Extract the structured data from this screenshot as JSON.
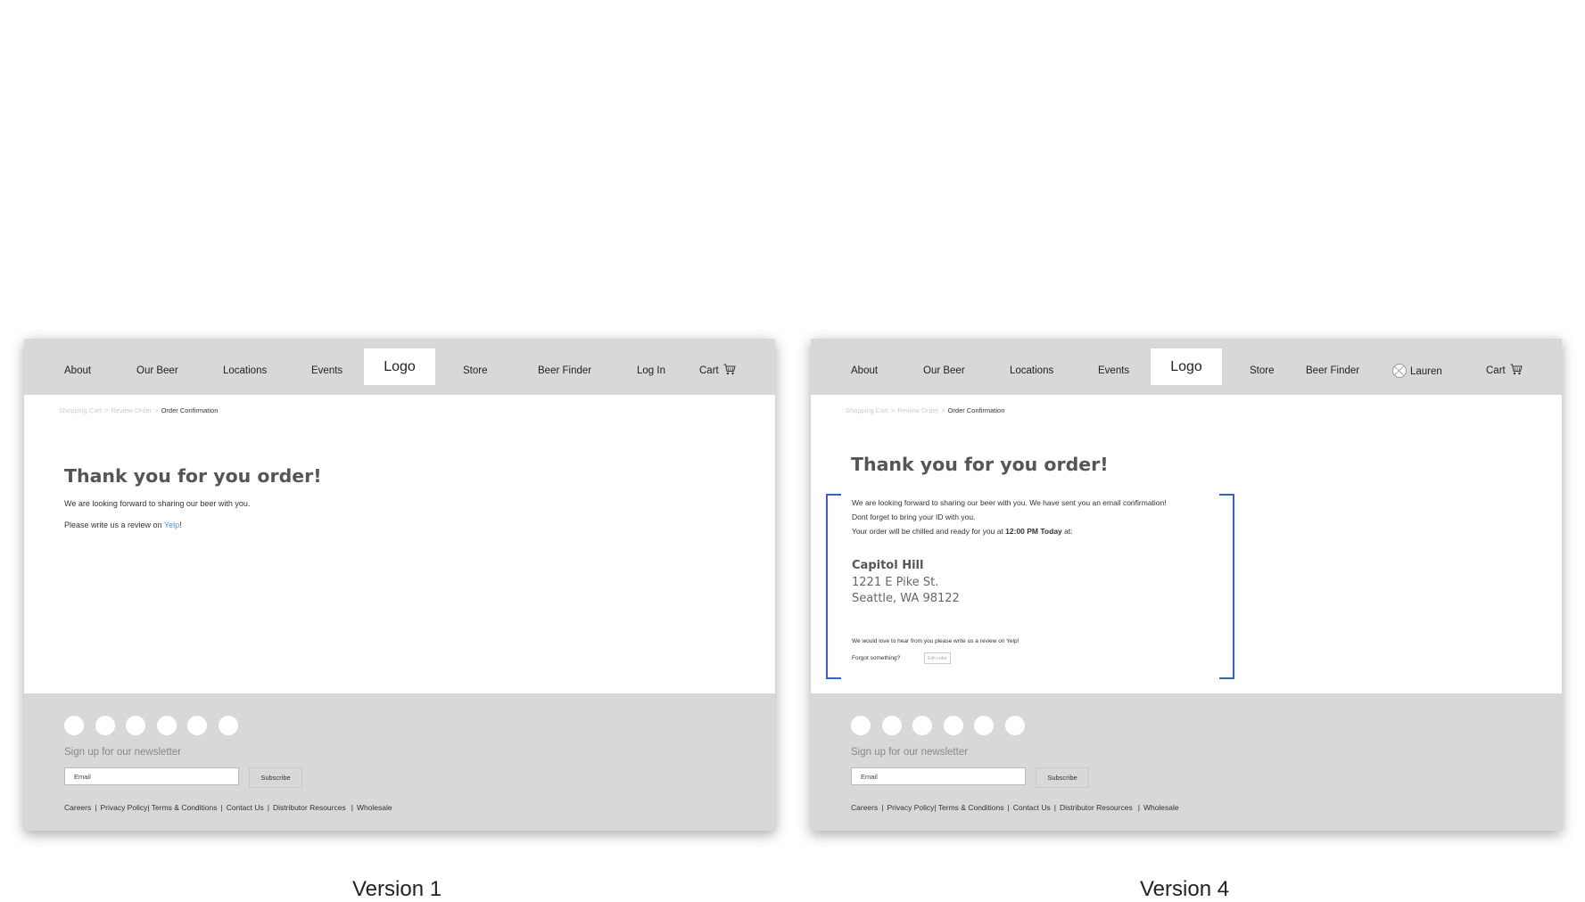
{
  "nav": {
    "about": "About",
    "our_beer": "Our Beer",
    "locations": "Locations",
    "events": "Events",
    "logo": "Logo",
    "store": "Store",
    "beer_finder": "Beer Finder",
    "log_in": "Log In",
    "user_name": "Lauren",
    "cart": "Cart"
  },
  "breadcrumb": {
    "step1": "Shopping Cart",
    "sep": ">",
    "step2": "Review Order",
    "current": "Order Confirmation"
  },
  "version1": {
    "caption": "Version 1",
    "title": "Thank you for you order!",
    "line1": "We are looking forward to sharing our beer with you.",
    "review_prefix": "Please write us a review on ",
    "review_link": "Yelp",
    "review_suffix": "!"
  },
  "version4": {
    "caption": "Version 4",
    "title": "Thank you for you order!",
    "line1": "We are looking forward to sharing our beer with you. We have sent you an email confirmation!",
    "line2": "Dont forget to bring your ID with you.",
    "line3_prefix": "Your order will be chilled and ready for you at ",
    "line3_time": "12:00 PM Today",
    "line3_suffix": " at:",
    "location_name": "Capitol Hill",
    "address_line1": "1221 E Pike St.",
    "address_line2": "Seattle, WA 98122",
    "review_text": "We would love to hear from you please write us a review on Yelp!",
    "forgot_text": "Forgot something?",
    "edit_button": "Edit order"
  },
  "footer": {
    "newsletter_label": "Sign up for our newsletter",
    "email_placeholder": "Email",
    "subscribe": "Subscribe",
    "links": [
      "Careers",
      "Privacy Policy",
      "Terms & Conditions",
      "Contact Us",
      "Distributor Resources",
      "Wholesale"
    ],
    "social_icon_count": 6
  },
  "colors": {
    "nav_bg": "#d8d8d8",
    "footer_bg": "#d8d8d8",
    "link": "#4a8fd8",
    "bracket": "#3366bb"
  },
  "icons": [
    "cart-icon",
    "avatar-icon",
    "social-icon"
  ]
}
